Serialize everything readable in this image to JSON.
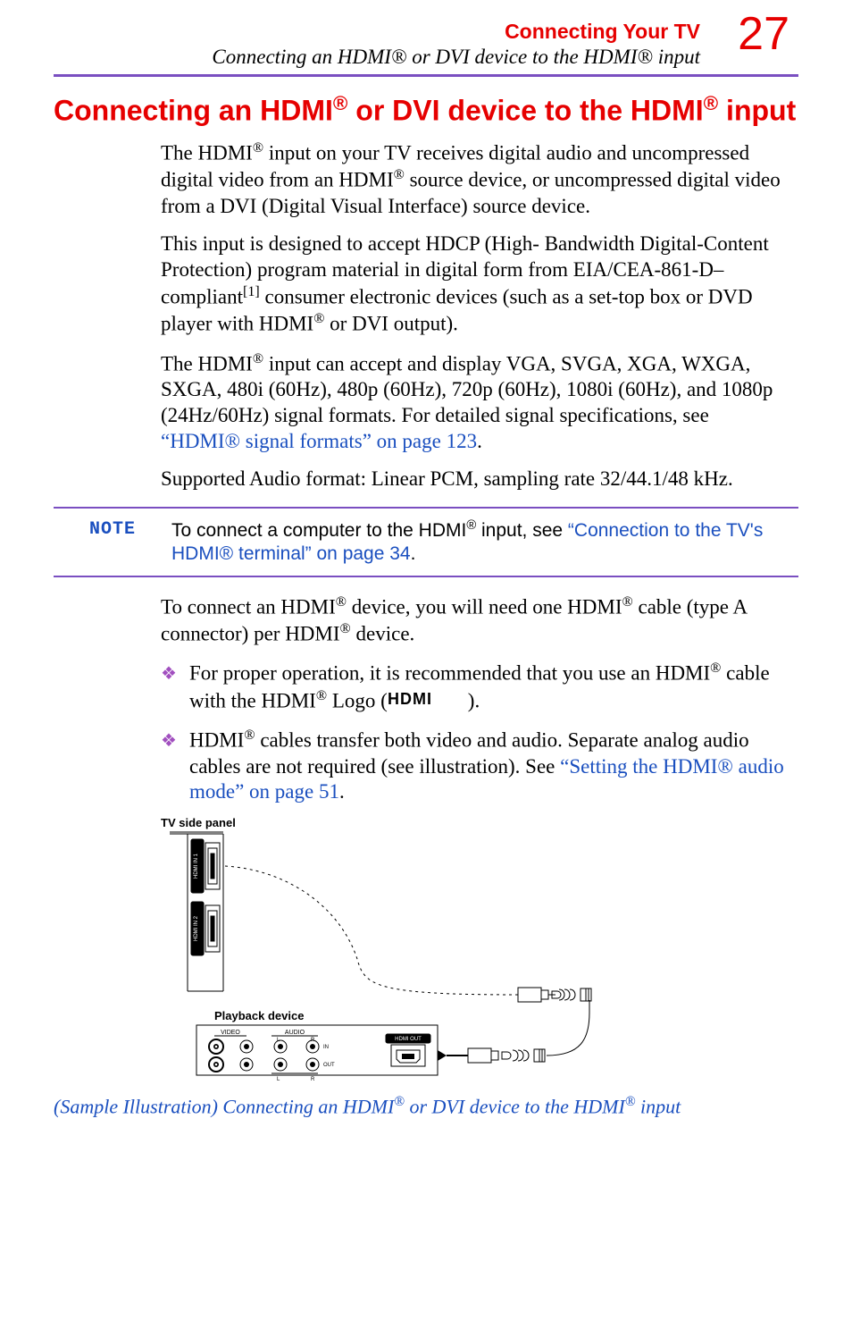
{
  "page_number": "27",
  "header": {
    "section": "Connecting Your TV",
    "subsection_prefix": "Connecting an HDMI",
    "subsection_mid": " or DVI device to the HDMI",
    "subsection_suffix": " input"
  },
  "heading": {
    "part1": "Connecting an HDMI",
    "part2": " or DVI device to the HDMI",
    "part3": " input"
  },
  "para1": {
    "a": "The HDMI",
    "b": " input on your TV receives digital audio and uncompressed digital video from an HDMI",
    "c": " source device, or uncompressed digital video from a DVI (Digital Visual Interface) source device."
  },
  "para2": {
    "a": "This input is designed to accept HDCP (High- Bandwidth Digital-Content Protection) program material in digital form from EIA/CEA-861-D– compliant",
    "b": " consumer electronic devices (such as a set-top box or DVD player with HDMI",
    "c": " or DVI output)."
  },
  "para3": {
    "a": "The HDMI",
    "b": " input can accept and display VGA, SVGA, XGA, WXGA, SXGA, 480i (60Hz), 480p (60Hz), 720p (60Hz), 1080i (60Hz), and 1080p (24Hz/60Hz) signal formats. For detailed signal specifications, see ",
    "link": "“HDMI® signal formats” on page 123",
    "c": "."
  },
  "para4": "Supported Audio format: Linear PCM, sampling rate 32/44.1/48 kHz.",
  "note": {
    "label": "NOTE",
    "a": "To connect a computer to the HDMI",
    "b": " input, see ",
    "link": "“Connection to the TV's HDMI® terminal” on page 34",
    "c": "."
  },
  "para5": {
    "a": "To connect an HDMI",
    "b": " device, you will need one HDMI",
    "c": " cable (type A connector) per HDMI",
    "d": " device."
  },
  "bullets": {
    "b1": {
      "a": "For proper operation, it is recommended that you use an HDMI",
      "b": " cable with the HDMI",
      "c": " Logo (",
      "d": ")."
    },
    "b2": {
      "a": "HDMI",
      "b": " cables transfer both video and audio. Separate analog audio cables are not required (see illustration). See ",
      "link": "“Setting the HDMI® audio mode” on page 51",
      "c": "."
    }
  },
  "diagram": {
    "tv_label": "TV side panel",
    "hdmi1": "HDMI IN 1",
    "hdmi2": "HDMI IN 2",
    "playback": "Playback device",
    "video": "VIDEO",
    "audio": "AUDIO",
    "in": "IN",
    "out": "OUT",
    "L": "L",
    "R": "R",
    "hdmi_out": "HDMI OUT"
  },
  "caption": {
    "a": "(Sample Illustration) Connecting an HDMI",
    "b": " or DVI device to the HDMI",
    "c": " input"
  },
  "reg": "®",
  "sup1": "[1]"
}
